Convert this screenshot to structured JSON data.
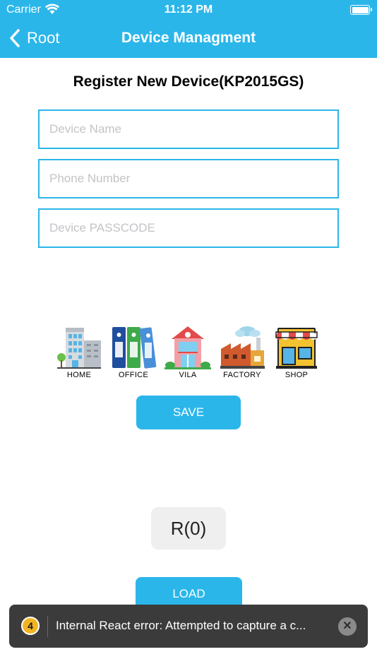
{
  "status_bar": {
    "carrier": "Carrier",
    "time": "11:12 PM"
  },
  "nav": {
    "back_label": "Root",
    "title": "Device Managment"
  },
  "form": {
    "heading": "Register New Device(KP2015GS)",
    "device_name": {
      "value": "",
      "placeholder": "Device Name"
    },
    "phone_number": {
      "value": "",
      "placeholder": "Phone Number"
    },
    "passcode": {
      "value": "",
      "placeholder": "Device PASSCODE"
    }
  },
  "device_types": [
    {
      "label": "HOME",
      "icon": "home-building-icon"
    },
    {
      "label": "OFFICE",
      "icon": "office-binders-icon"
    },
    {
      "label": "VILA",
      "icon": "villa-house-icon"
    },
    {
      "label": "FACTORY",
      "icon": "factory-icon"
    },
    {
      "label": "SHOP",
      "icon": "shop-storefront-icon"
    }
  ],
  "actions": {
    "save": "SAVE",
    "counter": "R(0)",
    "load": "LOAD"
  },
  "toast": {
    "count": "4",
    "message": "Internal React error: Attempted to capture a c...",
    "close": "✕"
  },
  "colors": {
    "accent": "#2bb6ea",
    "toast_bg": "#3b3b3b",
    "badge": "#f2b422"
  }
}
